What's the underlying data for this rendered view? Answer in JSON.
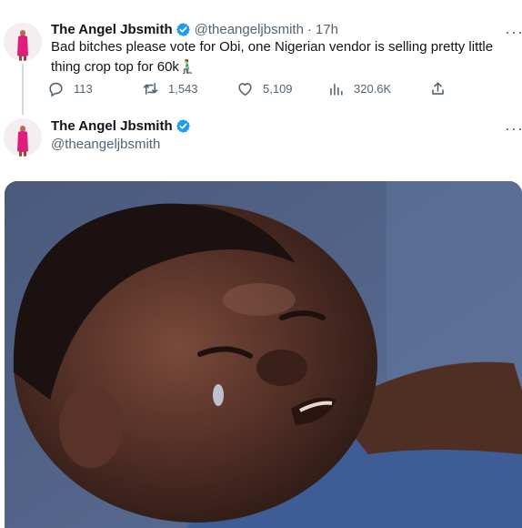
{
  "tweet": {
    "display_name": "The Angel Jbsmith",
    "handle": "@theangeljbsmith",
    "separator": "·",
    "time": "17h",
    "text": "Bad bitches please vote for Obi, one Nigerian vendor is selling pretty little thing crop top for 60k🧎‍♂️",
    "more": "···",
    "actions": {
      "replies": "113",
      "retweets": "1,543",
      "likes": "5,109",
      "views": "320.6K"
    }
  },
  "reply": {
    "display_name": "The Angel Jbsmith",
    "handle": "@theangeljbsmith",
    "more": "···"
  },
  "icons": {
    "verified": "verified-badge-icon",
    "reply": "reply-icon",
    "retweet": "retweet-icon",
    "like": "heart-icon",
    "views": "analytics-icon",
    "share": "share-icon"
  },
  "colors": {
    "verified": "#1d9bf0",
    "muted": "#536471",
    "text": "#0f1419"
  }
}
